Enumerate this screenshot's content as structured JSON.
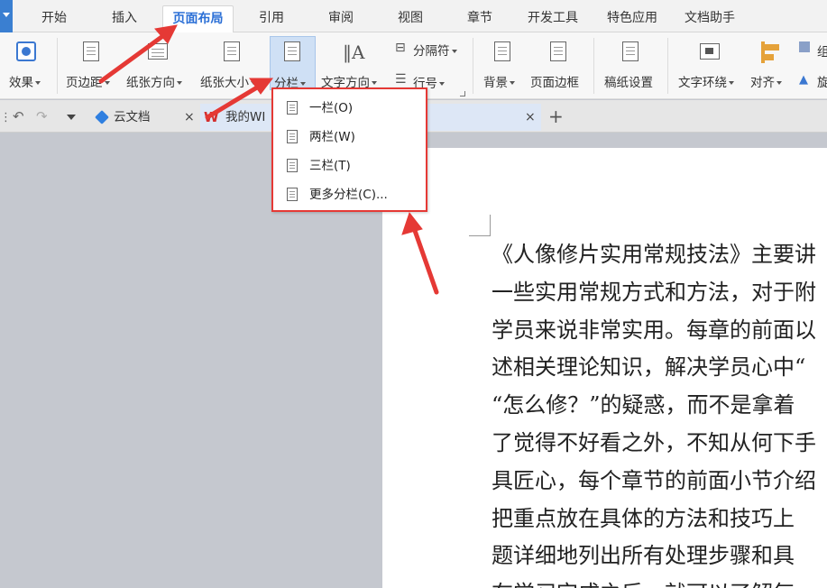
{
  "tabs": [
    {
      "label": "开始"
    },
    {
      "label": "插入"
    },
    {
      "label": "页面布局"
    },
    {
      "label": "引用"
    },
    {
      "label": "审阅"
    },
    {
      "label": "视图"
    },
    {
      "label": "章节"
    },
    {
      "label": "开发工具"
    },
    {
      "label": "特色应用"
    },
    {
      "label": "文档助手"
    }
  ],
  "ribbon": {
    "effects": "效果",
    "margins": "页边距",
    "orientation": "纸张方向",
    "size": "纸张大小",
    "columns": "分栏",
    "text_direction": "文字方向",
    "separator": "分隔符",
    "line_numbers": "行号",
    "background": "背景",
    "page_border": "页面边框",
    "manuscript": "稿纸设置",
    "wrap_text": "文字环绕",
    "align": "对齐",
    "partial_right_1": "组",
    "partial_right_2": "旋"
  },
  "doc_tabs": [
    {
      "label": "云文档"
    },
    {
      "label": "我的WI"
    }
  ],
  "columns_menu": [
    {
      "label": "一栏(O)"
    },
    {
      "label": "两栏(W)"
    },
    {
      "label": "三栏(T)"
    },
    {
      "label": "更多分栏(C)..."
    }
  ],
  "document": {
    "lines": [
      "《人像修片实用常规技法》主要讲",
      "一些实用常规方式和方法，对于附",
      "学员来说非常实用。每章的前面以",
      "述相关理论知识，解决学员心中“",
      "“怎么修？”的疑惑，而不是拿着",
      "了觉得不好看之外，不知从何下手",
      "具匠心，每个章节的前面小节介绍",
      "把重点放在具体的方法和技巧上",
      "题详细地列出所有处理步骤和具",
      "在学习完成之后，就可以了解每"
    ]
  },
  "colors": {
    "accent": "#2b6fd6",
    "annotation": "#e53935"
  }
}
